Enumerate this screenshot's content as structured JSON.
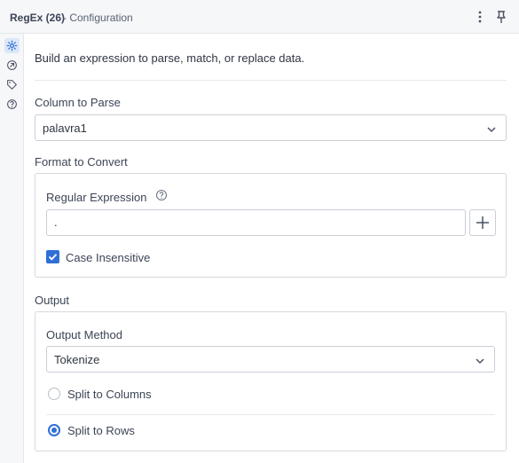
{
  "header": {
    "title": "RegEx (26)",
    "subtitle": "- Configuration",
    "kebab_icon": "more-vertical-icon",
    "pin_icon": "pin-icon"
  },
  "rail": {
    "items": [
      {
        "icon": "gear-icon",
        "active": true
      },
      {
        "icon": "circle-arrow-icon",
        "active": false
      },
      {
        "icon": "tag-icon",
        "active": false
      },
      {
        "icon": "question-circle-icon",
        "active": false
      }
    ]
  },
  "main": {
    "description": "Build an expression to parse, match, or replace data.",
    "column_to_parse": {
      "label": "Column to Parse",
      "value": "palavra1"
    },
    "format_section": {
      "title": "Format to Convert",
      "regex_label": "Regular Expression",
      "regex_value": ".",
      "case_insensitive_label": "Case Insensitive",
      "case_insensitive_checked": true
    },
    "output_section": {
      "title": "Output",
      "method_label": "Output Method",
      "method_value": "Tokenize",
      "options": [
        {
          "label": "Split to Columns",
          "selected": false
        },
        {
          "label": "Split to Rows",
          "selected": true
        }
      ]
    }
  },
  "colors": {
    "accent": "#2f6fd6",
    "border": "#c9ced6",
    "header_bg": "#f6f7f9"
  }
}
